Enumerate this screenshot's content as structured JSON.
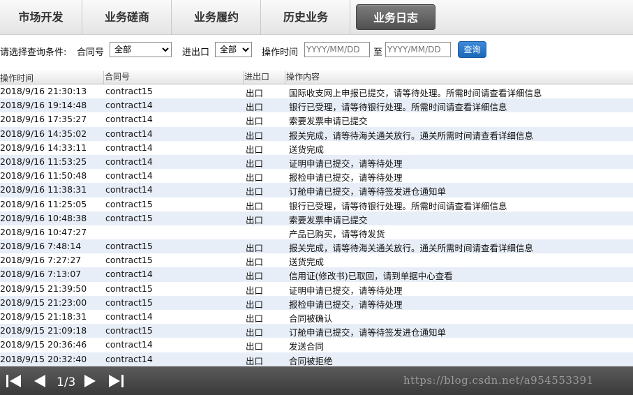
{
  "tabs": [
    {
      "label": "市场开发",
      "active": false
    },
    {
      "label": "业务磋商",
      "active": false
    },
    {
      "label": "业务履约",
      "active": false
    },
    {
      "label": "历史业务",
      "active": false
    },
    {
      "label": "业务日志",
      "active": true
    }
  ],
  "filter": {
    "prompt": "请选择查询条件:",
    "contract_label": "合同号",
    "contract_value": "全部",
    "io_label": "进出口",
    "io_value": "全部",
    "time_label": "操作时间",
    "from_placeholder": "YYYY/MM/DD",
    "to_label": "至",
    "to_placeholder": "YYYY/MM/DD",
    "query_button": "查询"
  },
  "table": {
    "headers": [
      "操作时间",
      "合同号",
      "进出口",
      "操作内容"
    ],
    "rows": [
      {
        "time": "2018/9/16 21:30:13",
        "contract": "contract15",
        "io": "出口",
        "desc": "国际收支网上申报已提交，请等待处理。所需时间请查看详细信息"
      },
      {
        "time": "2018/9/16 19:14:48",
        "contract": "contract14",
        "io": "出口",
        "desc": "银行已受理，请等待银行处理。所需时间请查看详细信息"
      },
      {
        "time": "2018/9/16 17:35:27",
        "contract": "contract14",
        "io": "出口",
        "desc": "索要发票申请已提交"
      },
      {
        "time": "2018/9/16 14:35:02",
        "contract": "contract14",
        "io": "出口",
        "desc": "报关完成，请等待海关通关放行。通关所需时间请查看详细信息"
      },
      {
        "time": "2018/9/16 14:33:11",
        "contract": "contract14",
        "io": "出口",
        "desc": "送货完成"
      },
      {
        "time": "2018/9/16 11:53:25",
        "contract": "contract14",
        "io": "出口",
        "desc": "证明申请已提交，请等待处理"
      },
      {
        "time": "2018/9/16 11:50:48",
        "contract": "contract14",
        "io": "出口",
        "desc": "报检申请已提交，请等待处理"
      },
      {
        "time": "2018/9/16 11:38:31",
        "contract": "contract14",
        "io": "出口",
        "desc": "订舱申请已提交，请等待签发进仓通知单"
      },
      {
        "time": "2018/9/16 11:25:05",
        "contract": "contract15",
        "io": "出口",
        "desc": "银行已受理，请等待银行处理。所需时间请查看详细信息"
      },
      {
        "time": "2018/9/16 10:48:38",
        "contract": "contract15",
        "io": "出口",
        "desc": "索要发票申请已提交"
      },
      {
        "time": "2018/9/16 10:47:27",
        "contract": "",
        "io": "",
        "desc": "产品已购买，请等待发货"
      },
      {
        "time": "2018/9/16 7:48:14",
        "contract": "contract15",
        "io": "出口",
        "desc": "报关完成，请等待海关通关放行。通关所需时间请查看详细信息"
      },
      {
        "time": "2018/9/16 7:27:27",
        "contract": "contract15",
        "io": "出口",
        "desc": "送货完成"
      },
      {
        "time": "2018/9/16 7:13:07",
        "contract": "contract14",
        "io": "出口",
        "desc": "信用证(修改书)已取回，请到单据中心查看"
      },
      {
        "time": "2018/9/15 21:39:50",
        "contract": "contract15",
        "io": "出口",
        "desc": "证明申请已提交，请等待处理"
      },
      {
        "time": "2018/9/15 21:23:00",
        "contract": "contract15",
        "io": "出口",
        "desc": "报检申请已提交，请等待处理"
      },
      {
        "time": "2018/9/15 21:18:31",
        "contract": "contract14",
        "io": "出口",
        "desc": "合同被确认"
      },
      {
        "time": "2018/9/15 21:09:18",
        "contract": "contract15",
        "io": "出口",
        "desc": "订舱申请已提交，请等待签发进仓通知单"
      },
      {
        "time": "2018/9/15 20:36:46",
        "contract": "contract14",
        "io": "出口",
        "desc": "发送合同"
      },
      {
        "time": "2018/9/15 20:32:40",
        "contract": "contract14",
        "io": "出口",
        "desc": "合同被拒绝"
      }
    ]
  },
  "pager": {
    "page_info": "1/3",
    "icons": [
      "first-page-icon",
      "prev-page-icon",
      "next-page-icon",
      "last-page-icon"
    ]
  },
  "watermark": "https://blog.csdn.net/a954553391",
  "colors": {
    "accent": "#1e67b8",
    "row_alt": "#e8eef7",
    "pager_bg": "#4a4a4a",
    "active_tab": "#606060"
  }
}
